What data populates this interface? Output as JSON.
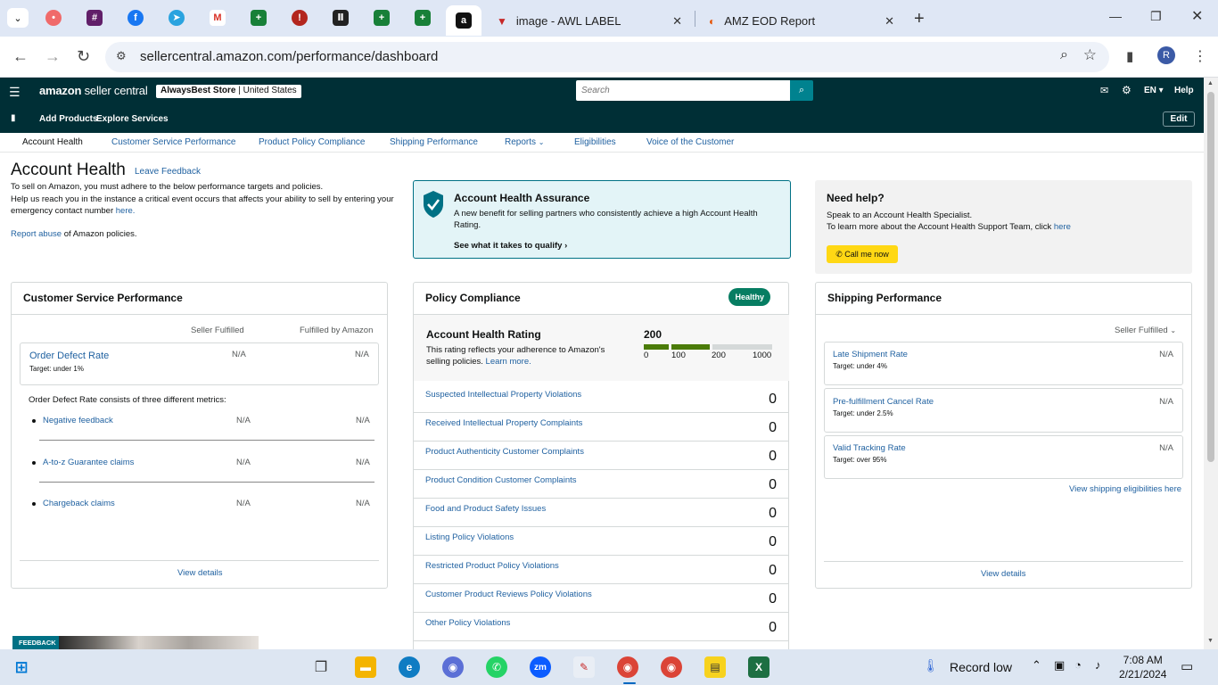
{
  "browser": {
    "tabs": [
      {
        "title": "image - AWL LABEL"
      },
      {
        "title": "AMZ EOD Report"
      }
    ],
    "url": "sellercentral.amazon.com/performance/dashboard",
    "profile_initial": "R"
  },
  "header": {
    "logo_main": "amazon",
    "logo_sub": "seller central",
    "store_name": "AlwaysBest Store",
    "store_region": "United States",
    "search_placeholder": "Search",
    "lang": "EN",
    "help": "Help",
    "sub_links": [
      "Add Products",
      "Explore Services"
    ],
    "edit": "Edit"
  },
  "page_tabs": [
    "Account Health",
    "Customer Service Performance",
    "Product Policy Compliance",
    "Shipping Performance",
    "Reports",
    "Eligibilities",
    "Voice of the Customer"
  ],
  "intro": {
    "title": "Account Health",
    "leave_feedback": "Leave Feedback",
    "line1": "To sell on Amazon, you must adhere to the below performance targets and policies.",
    "line2_before": "Help us reach you in the instance a critical event occurs that affects your ability to sell by entering your emergency contact number",
    "line2_link": "here.",
    "report_link": "Report abuse",
    "report_rest": "of Amazon policies."
  },
  "aha": {
    "title": "Account Health Assurance",
    "desc": "A new benefit for selling partners who consistently achieve a high Account Health Rating.",
    "link": "See what it takes to qualify"
  },
  "help": {
    "title": "Need help?",
    "line1": "Speak to an Account Health Specialist.",
    "line2": "To learn more about the Account Health Support Team, click",
    "line2_link": "here",
    "call_button": "Call me now"
  },
  "csp": {
    "title": "Customer Service Performance",
    "col1": "Seller Fulfilled",
    "col2": "Fulfilled by Amazon",
    "odr_label": "Order Defect Rate",
    "odr_target": "Target: under 1%",
    "odr_sf": "N/A",
    "odr_fba": "N/A",
    "consists": "Order Defect Rate consists of three different metrics:",
    "metrics": [
      {
        "label": "Negative feedback",
        "sf": "N/A",
        "fba": "N/A"
      },
      {
        "label": "A-to-z Guarantee claims",
        "sf": "N/A",
        "fba": "N/A"
      },
      {
        "label": "Chargeback claims",
        "sf": "N/A",
        "fba": "N/A"
      }
    ],
    "view_details": "View details"
  },
  "policy": {
    "title": "Policy Compliance",
    "badge": "Healthy",
    "ahr_title": "Account Health Rating",
    "ahr_desc": "This rating reflects your adherence to Amazon's selling policies.",
    "ahr_learn": "Learn more.",
    "ahr_score": "200",
    "ahr_ticks": [
      "0",
      "100",
      "200",
      "1000"
    ],
    "ahr_fraction": 0.2,
    "rows": [
      {
        "label": "Suspected Intellectual Property Violations",
        "value": "0"
      },
      {
        "label": "Received Intellectual Property Complaints",
        "value": "0"
      },
      {
        "label": "Product Authenticity Customer Complaints",
        "value": "0"
      },
      {
        "label": "Product Condition Customer Complaints",
        "value": "0"
      },
      {
        "label": "Food and Product Safety Issues",
        "value": "0"
      },
      {
        "label": "Listing Policy Violations",
        "value": "0"
      },
      {
        "label": "Restricted Product Policy Violations",
        "value": "0"
      },
      {
        "label": "Customer Product Reviews Policy Violations",
        "value": "0"
      },
      {
        "label": "Other Policy Violations",
        "value": "0"
      }
    ]
  },
  "shipping": {
    "title": "Shipping Performance",
    "filter": "Seller Fulfilled",
    "metrics": [
      {
        "label": "Late Shipment Rate",
        "target": "Target: under 4%",
        "value": "N/A"
      },
      {
        "label": "Pre-fulfillment Cancel Rate",
        "target": "Target: under 2.5%",
        "value": "N/A"
      },
      {
        "label": "Valid Tracking Rate",
        "target": "Target: over 95%",
        "value": "N/A"
      }
    ],
    "eligibilities_link": "View shipping eligibilities here",
    "view_details": "View details"
  },
  "feedback": "FEEDBACK",
  "taskbar": {
    "weather": "Record low",
    "time": "7:08 AM",
    "date": "2/21/2024"
  },
  "colors": {
    "header_bg": "#002f36",
    "link": "#2162a1",
    "healthy": "#067d62",
    "rating_bar": "#4b7c09",
    "call_button": "#ffd814"
  }
}
